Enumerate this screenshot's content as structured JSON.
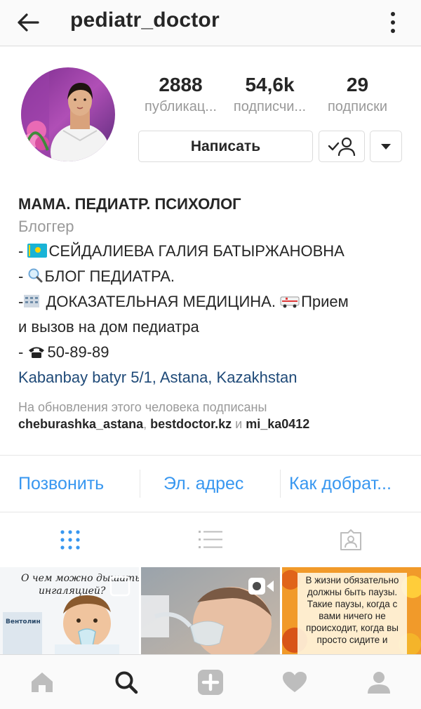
{
  "header": {
    "username": "pediatr_doctor"
  },
  "stats": [
    {
      "value": "2888",
      "label": "публикац..."
    },
    {
      "value": "54,6k",
      "label": "подписчи..."
    },
    {
      "value": "29",
      "label": "подписки"
    }
  ],
  "buttons": {
    "message": "Написать"
  },
  "bio": {
    "name": "МАМА. ПЕДИАТР. ПСИХОЛОГ",
    "category": "Блоггер",
    "line1_prefix": "- ",
    "line1_text": "СЕЙДАЛИЕВА ГАЛИЯ БАТЫРЖАНОВНА",
    "line2_prefix": "- ",
    "line2_text": "БЛОГ ПЕДИАТРА.",
    "line3_prefix": "-",
    "line3_text": " ДОКАЗАТЕЛЬНАЯ МЕДИЦИНА. ",
    "line3_tail": "Прием",
    "line4_text": "и вызов на дом педиатра",
    "line5_prefix": "- ",
    "line5_text": "50-89-89",
    "location": "Kabanbay batyr 5/1, Astana, Kazakhstan"
  },
  "followed_by": {
    "header": "На обновления этого человека подписаны",
    "user1": "cheburashka_astana",
    "sep1": ", ",
    "user2": "bestdoctor.kz",
    "and": " и ",
    "user3": "mi_ka0412"
  },
  "actions": {
    "call": "Позвонить",
    "email": "Эл. адрес",
    "directions": "Как добрат..."
  },
  "tabs": [
    "grid-icon",
    "list-icon",
    "tagged-icon"
  ],
  "posts": [
    {
      "text1": "О чем можно дышать",
      "text2": "ингаляцией?",
      "box_label": "Вентолин"
    },
    {
      "type": "video"
    },
    {
      "text": "В жизни обязательно должны быть паузы. Такие паузы, когда с вами ничего не происходит, когда вы просто сидите и"
    }
  ],
  "bottom_nav": [
    "home-icon",
    "search-icon",
    "add-icon",
    "heart-icon",
    "profile-icon"
  ],
  "colors": {
    "accent": "#3897f0",
    "location": "#1f4a78",
    "muted": "#999999"
  }
}
